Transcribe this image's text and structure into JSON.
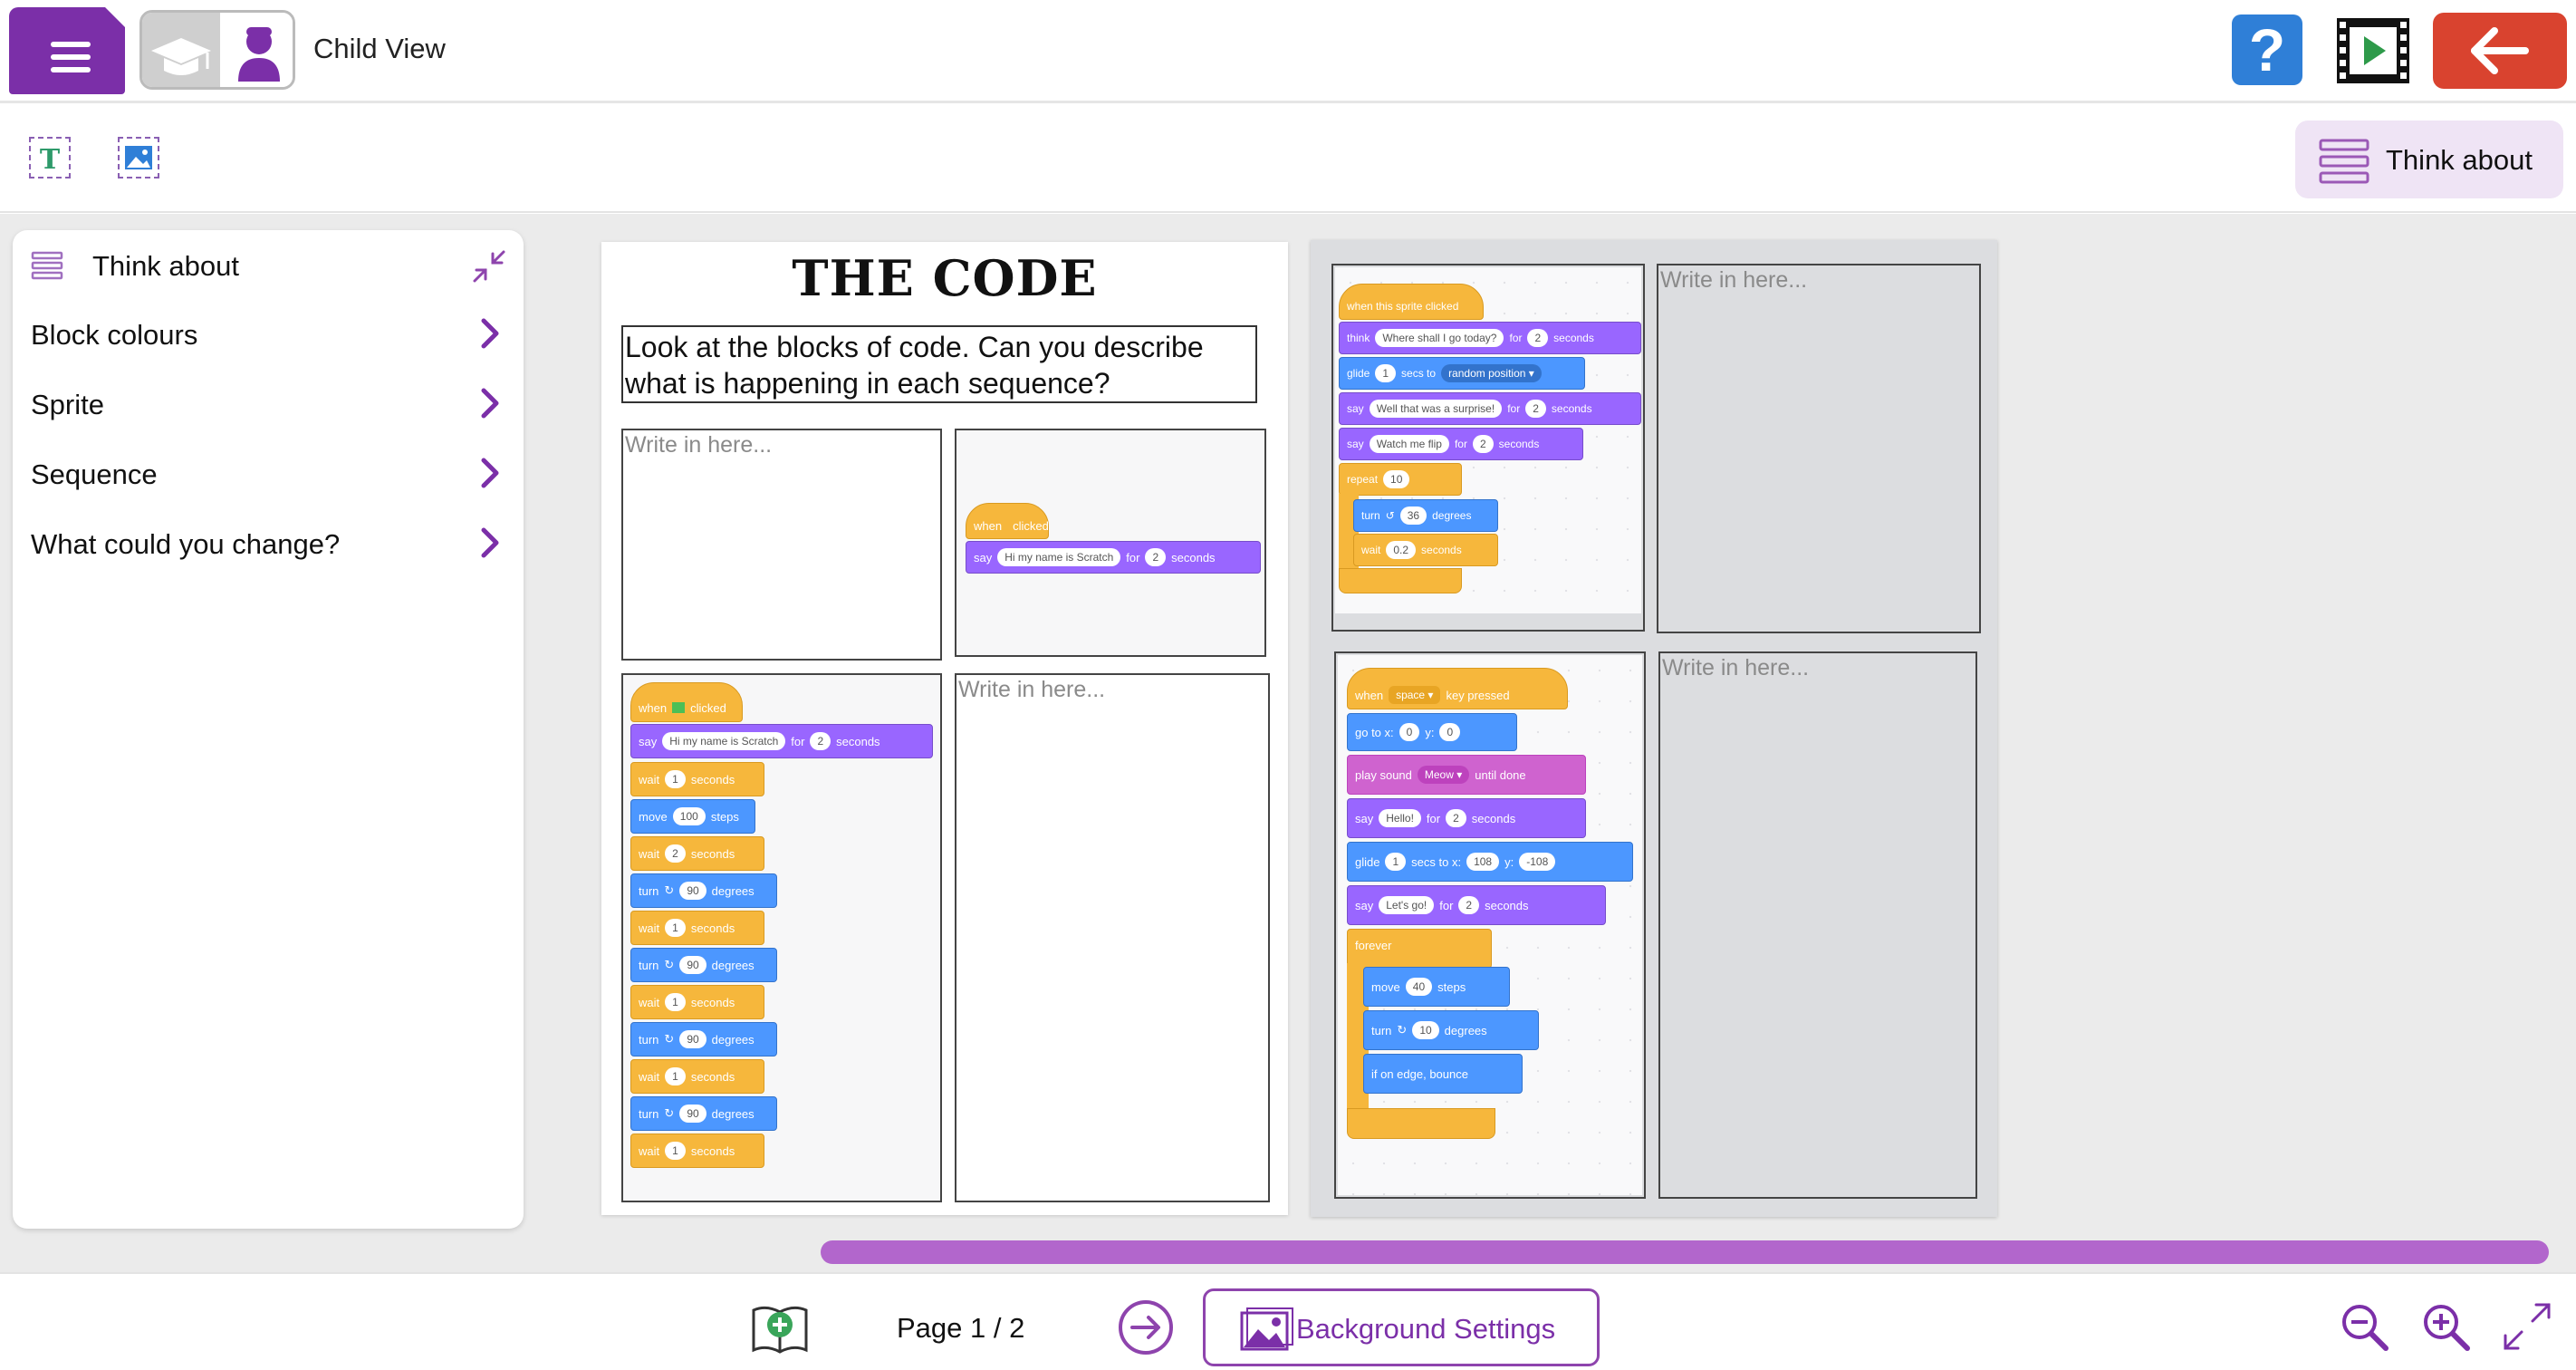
{
  "header": {
    "view_label": "Child View",
    "help_glyph": "?",
    "icons": [
      "menu-icon",
      "graduation-cap-icon",
      "child-icon",
      "help-icon",
      "video-icon",
      "back-arrow-icon"
    ],
    "colors": {
      "menu": "#7b2fa8",
      "help": "#2f7fd7",
      "back": "#d9432f"
    }
  },
  "toolbar": {
    "think_button_label": "Think about",
    "tools": [
      "text-tool-icon",
      "image-tool-icon"
    ]
  },
  "panel": {
    "title": "Think about",
    "items": [
      {
        "label": "Block colours"
      },
      {
        "label": "Sprite"
      },
      {
        "label": "Sequence"
      },
      {
        "label": "What could you change?"
      }
    ]
  },
  "page1": {
    "title": "THE CODE",
    "prompt": "Look at the blocks of code. Can you describe what is happening in each sequence?",
    "placeholder": "Write in here..."
  },
  "page2": {
    "placeholder": "Write in here..."
  },
  "scripts": {
    "s1": {
      "hat": [
        "when",
        "clicked"
      ],
      "say": [
        "say",
        "Hi my name is Scratch",
        "for",
        "2",
        "seconds"
      ]
    },
    "s2": {
      "hat": [
        "when",
        "clicked"
      ],
      "say": [
        "say",
        "Hi my name is Scratch",
        "for",
        "2",
        "seconds"
      ],
      "w1": [
        "wait",
        "1",
        "seconds"
      ],
      "move": [
        "move",
        "100",
        "steps"
      ],
      "w2": [
        "wait",
        "2",
        "seconds"
      ],
      "turn": [
        "turn",
        "90",
        "degrees"
      ],
      "wait": [
        "wait",
        "1",
        "seconds"
      ]
    },
    "s3": {
      "hat": "when this sprite clicked",
      "think": [
        "think",
        "Where shall I go today?",
        "for",
        "2",
        "seconds"
      ],
      "glide": [
        "glide",
        "1",
        "secs to",
        "random position ▾"
      ],
      "say1": [
        "say",
        "Well that was a surprise!",
        "for",
        "2",
        "seconds"
      ],
      "say2": [
        "say",
        "Watch me flip",
        "for",
        "2",
        "seconds"
      ],
      "repeat": [
        "repeat",
        "10"
      ],
      "turn": [
        "turn",
        "36",
        "degrees"
      ],
      "wait": [
        "wait",
        "0.2",
        "seconds"
      ]
    },
    "s4": {
      "hat": [
        "when",
        "space ▾",
        "key pressed"
      ],
      "goto": [
        "go to x:",
        "0",
        "y:",
        "0"
      ],
      "sound": [
        "play sound",
        "Meow ▾",
        "until done"
      ],
      "say1": [
        "say",
        "Hello!",
        "for",
        "2",
        "seconds"
      ],
      "glide": [
        "glide",
        "1",
        "secs to x:",
        "108",
        "y:",
        "-108"
      ],
      "say2": [
        "say",
        "Let's go!",
        "for",
        "2",
        "seconds"
      ],
      "forever": "forever",
      "move": [
        "move",
        "40",
        "steps"
      ],
      "turn": [
        "turn",
        "10",
        "degrees"
      ],
      "bounce": "if on edge, bounce"
    }
  },
  "footer": {
    "page_indicator": "Page 1 / 2",
    "background_button_label": "Background Settings",
    "icons": [
      "add-page-icon",
      "next-page-icon",
      "background-image-icon",
      "zoom-out-icon",
      "zoom-in-icon",
      "fullscreen-icon"
    ]
  }
}
